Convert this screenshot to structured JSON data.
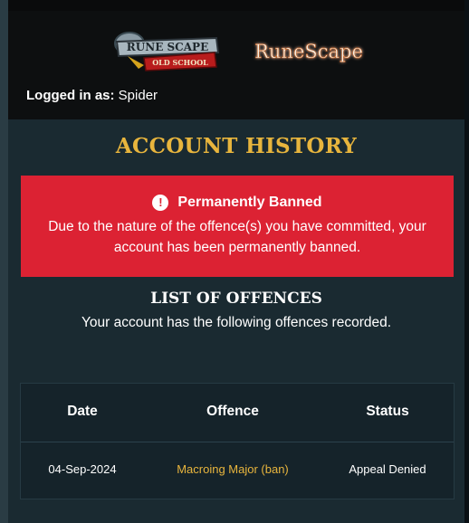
{
  "header": {
    "osrs_logo_text": "RUNE SCAPE",
    "osrs_logo_subtext": "OLD SCHOOL",
    "rs_logo_text": "RuneScape",
    "logged_in_label": "Logged in as:",
    "username": "Spider"
  },
  "main": {
    "title": "ACCOUNT HISTORY",
    "banner": {
      "icon": "alert-circle-icon",
      "heading": "Permanently Banned",
      "message": "Due to the nature of the offence(s) you have committed, your account has been permanently banned.",
      "color": "#dc2233"
    },
    "offences_title": "LIST OF OFFENCES",
    "offences_subtitle": "Your account has the following offences recorded.",
    "table": {
      "columns": [
        "Date",
        "Offence",
        "Status"
      ],
      "rows": [
        {
          "date": "04-Sep-2024",
          "offence": "Macroing Major (ban)",
          "status": "Appeal Denied"
        }
      ]
    }
  },
  "colors": {
    "accent_gold": "#e8b53d",
    "background": "#1a2a31",
    "header_bg": "#0d0f10"
  }
}
